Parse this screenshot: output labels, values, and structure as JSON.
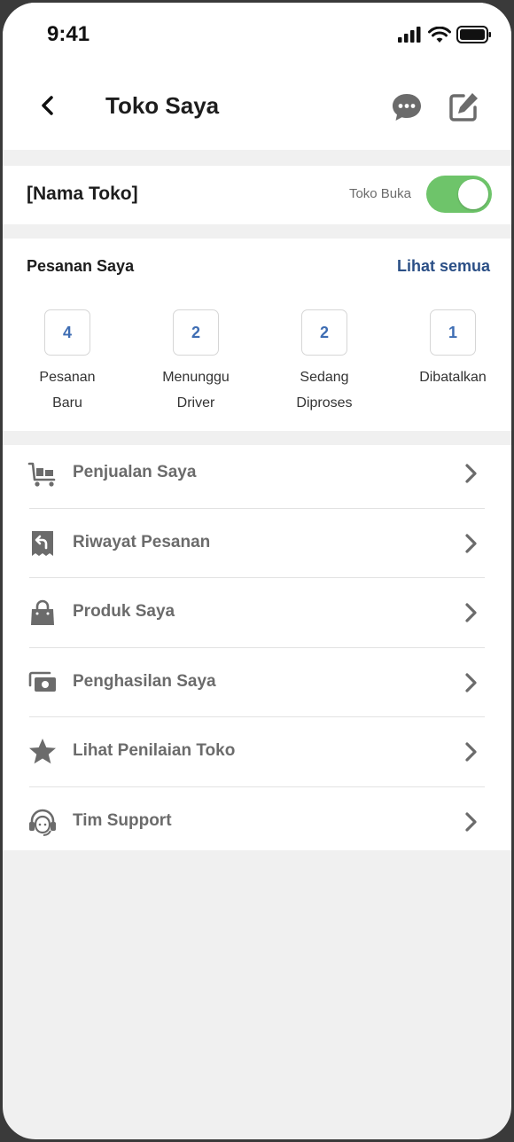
{
  "status_bar": {
    "time": "9:41"
  },
  "appbar": {
    "title": "Toko Saya"
  },
  "store": {
    "name": "[Nama Toko]",
    "status_label": "Toko Buka",
    "is_open": true
  },
  "orders": {
    "title": "Pesanan Saya",
    "see_all": "Lihat semua",
    "stats": [
      {
        "count": "4",
        "label_line1": "Pesanan",
        "label_line2": "Baru"
      },
      {
        "count": "2",
        "label_line1": "Menunggu",
        "label_line2": "Driver"
      },
      {
        "count": "2",
        "label_line1": "Sedang",
        "label_line2": "Diproses"
      },
      {
        "count": "1",
        "label_line1": "Dibatalkan",
        "label_line2": ""
      }
    ]
  },
  "menu": [
    {
      "label": "Penjualan Saya",
      "icon": "cart-icon"
    },
    {
      "label": "Riwayat Pesanan",
      "icon": "receipt-return-icon"
    },
    {
      "label": "Produk Saya",
      "icon": "shopping-bag-icon"
    },
    {
      "label": "Penghasilan Saya",
      "icon": "money-icon"
    },
    {
      "label": "Lihat Penilaian Toko",
      "icon": "star-icon"
    },
    {
      "label": "Tim Support",
      "icon": "headset-icon"
    }
  ],
  "colors": {
    "accent": "#2b4f86",
    "badge_text": "#3e6db3",
    "toggle_on": "#6ec46a",
    "icon": "#6b6b6b"
  }
}
